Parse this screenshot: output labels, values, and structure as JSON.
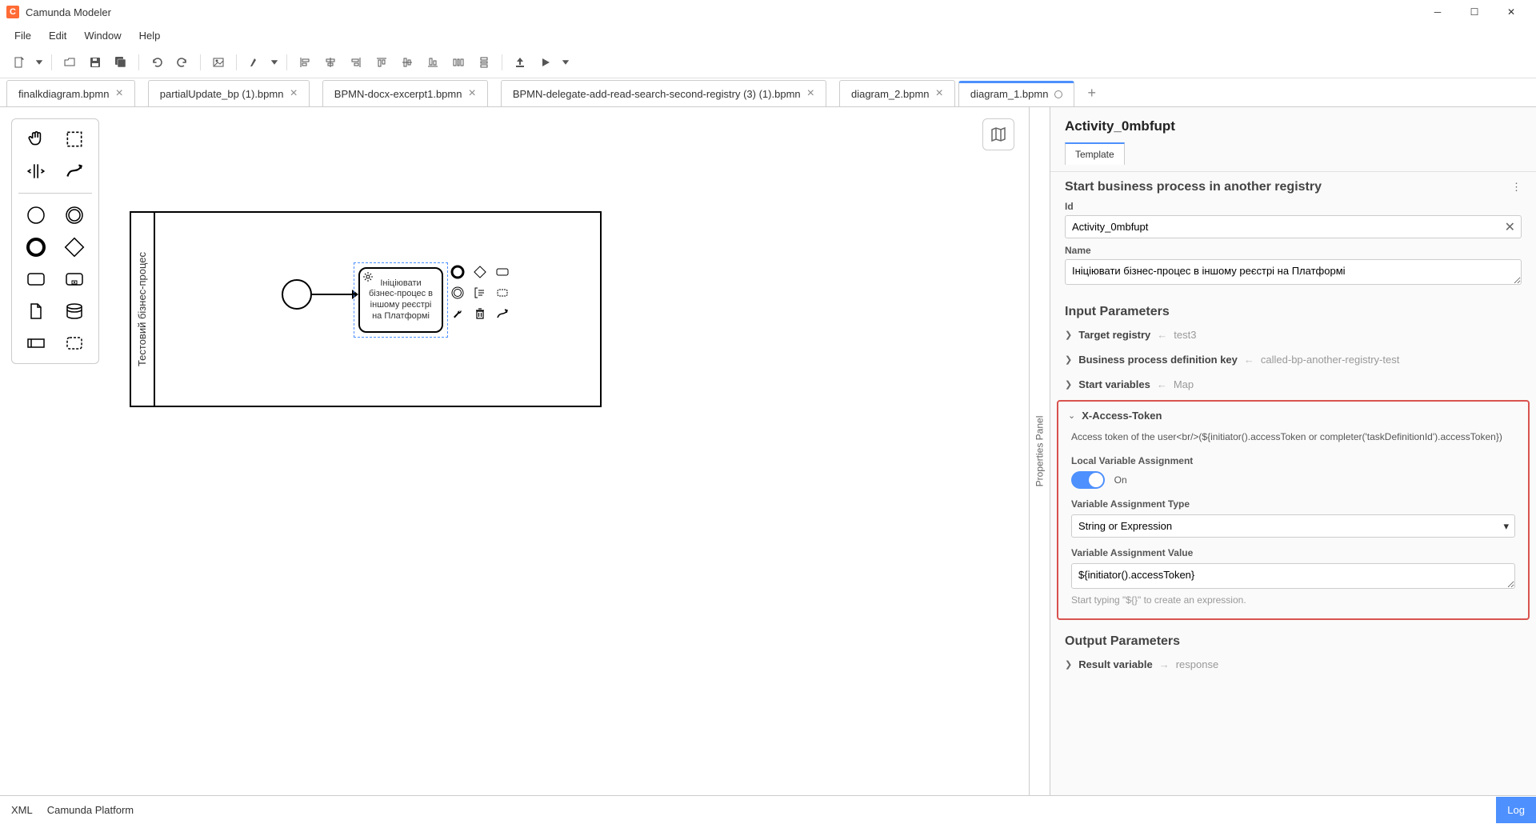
{
  "app": {
    "title": "Camunda Modeler"
  },
  "menu": {
    "file": "File",
    "edit": "Edit",
    "window": "Window",
    "help": "Help"
  },
  "tabs": [
    {
      "label": "finalkdiagram.bpmn",
      "active": false
    },
    {
      "label": "partialUpdate_bp (1).bpmn",
      "active": false
    },
    {
      "label": "BPMN-docx-excerpt1.bpmn",
      "active": false
    },
    {
      "label": "BPMN-delegate-add-read-search-second-registry (3) (1).bpmn",
      "active": false
    },
    {
      "label": "diagram_2.bpmn",
      "active": false
    },
    {
      "label": "diagram_1.bpmn",
      "active": true
    }
  ],
  "canvas": {
    "pool_label": "Тестовий бізнес-процес",
    "task_label": "Ініціювати бізнес-процес в іншому реєстрі на Платформі"
  },
  "props": {
    "panel_tab": "Properties Panel",
    "title": "Activity_0mbfupt",
    "sub_tab": "Template",
    "section1_title": "Start business process in another registry",
    "id_label": "Id",
    "id_value": "Activity_0mbfupt",
    "name_label": "Name",
    "name_value": "Ініціювати бізнес-процес в іншому реєстрі на Платформі",
    "input_params_title": "Input Parameters",
    "params": {
      "target_registry": {
        "name": "Target registry",
        "val": "test3"
      },
      "bp_def_key": {
        "name": "Business process definition key",
        "val": "called-bp-another-registry-test"
      },
      "start_vars": {
        "name": "Start variables",
        "val": "Map"
      }
    },
    "token": {
      "name": "X-Access-Token",
      "desc": "Access token of the user<br/>(${initiator().accessToken or completer('taskDefinitionId').accessToken})",
      "local_label": "Local Variable Assignment",
      "local_state": "On",
      "type_label": "Variable Assignment Type",
      "type_value": "String or Expression",
      "value_label": "Variable Assignment Value",
      "value": "${initiator().accessToken}",
      "hint": "Start typing \"${}\" to create an expression."
    },
    "output_title": "Output Parameters",
    "output": {
      "name": "Result variable",
      "val": "response"
    }
  },
  "status": {
    "xml": "XML",
    "platform": "Camunda Platform",
    "log": "Log"
  }
}
